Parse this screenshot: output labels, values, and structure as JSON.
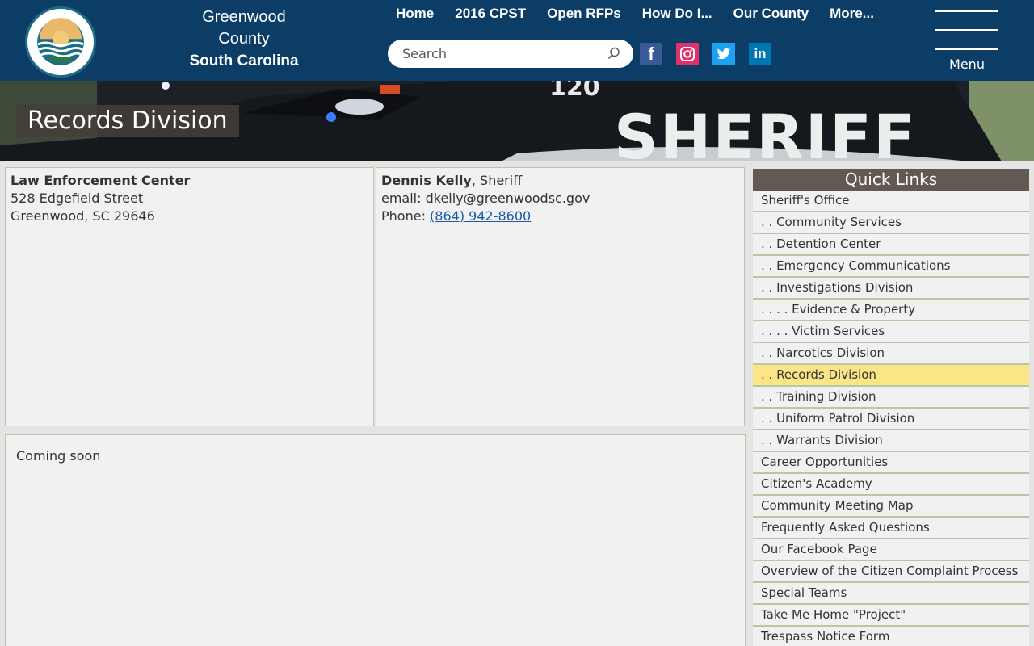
{
  "header": {
    "logo_alt": "Greenwood County South Carolina seal",
    "logo_text_top": "GREENWOOD COUNTY",
    "logo_text_bottom": "SOUTH CAROLINA",
    "logo_est": "EST 1897",
    "county_line1": "Greenwood",
    "county_line2": "County",
    "county_line3": "South Carolina",
    "nav": [
      "Home",
      "2016 CPST",
      "Open RFPs",
      "How Do I...",
      "Our County",
      "More..."
    ],
    "search_placeholder": "Search",
    "social": [
      {
        "name": "facebook-icon",
        "glyph": "f",
        "color": "#3b5998"
      },
      {
        "name": "instagram-icon",
        "glyph": "",
        "color": "#e1306c"
      },
      {
        "name": "twitter-icon",
        "glyph": "",
        "color": "#1da1f2"
      },
      {
        "name": "linkedin-icon",
        "glyph": "in",
        "color": "#0077b5"
      }
    ],
    "menu_label": "Menu"
  },
  "banner": {
    "title": "Records Division",
    "car_text": "SHERIFF",
    "car_number": "120"
  },
  "address_panel": {
    "name": "Law Enforcement Center",
    "street": "528 Edgefield Street",
    "city": "Greenwood, SC 29646"
  },
  "contact_panel": {
    "person": "Dennis Kelly",
    "title_suffix": ", Sheriff",
    "email_label": "email: ",
    "email": "dkelly@greenwoodsc.gov",
    "phone_label": "Phone: ",
    "phone": "(864) 942-8600"
  },
  "main": {
    "text": "Coming soon"
  },
  "quick_links": {
    "heading": "Quick Links",
    "items": [
      {
        "label": "Sheriff's Office",
        "active": false
      },
      {
        "label": ". . Community Services",
        "active": false
      },
      {
        "label": ". . Detention Center",
        "active": false
      },
      {
        "label": ". . Emergency Communications",
        "active": false
      },
      {
        "label": ". . Investigations Division",
        "active": false
      },
      {
        "label": ". . . . Evidence & Property",
        "active": false
      },
      {
        "label": ". . . . Victim Services",
        "active": false
      },
      {
        "label": ". . Narcotics Division",
        "active": false
      },
      {
        "label": ". . Records Division",
        "active": true
      },
      {
        "label": ". . Training Division",
        "active": false
      },
      {
        "label": ". . Uniform Patrol Division",
        "active": false
      },
      {
        "label": ". . Warrants Division",
        "active": false
      },
      {
        "label": "Career Opportunities",
        "active": false
      },
      {
        "label": "Citizen's Academy",
        "active": false
      },
      {
        "label": "Community Meeting Map",
        "active": false
      },
      {
        "label": "Frequently Asked Questions",
        "active": false
      },
      {
        "label": "Our Facebook Page",
        "active": false
      },
      {
        "label": "Overview of the Citizen Complaint Process",
        "active": false
      },
      {
        "label": "Special Teams",
        "active": false
      },
      {
        "label": "Take Me Home \"Project\"",
        "active": false
      },
      {
        "label": "Trespass Notice Form",
        "active": false
      }
    ]
  },
  "colors": {
    "header_bg": "#0c3d66",
    "panel_bg": "#f1f1f1",
    "panel_border": "#b9c8a4",
    "quicklinks_head": "#625952",
    "active_item": "#fbe586",
    "link": "#1a5aa6"
  }
}
